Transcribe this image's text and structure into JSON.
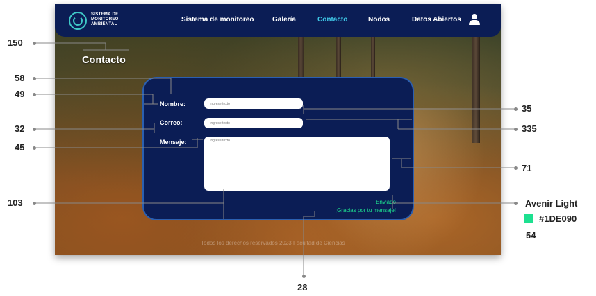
{
  "logo": {
    "line1": "SISTEMA DE",
    "line2": "MONITOREO",
    "line3": "AMBIENTAL"
  },
  "nav": {
    "items": [
      {
        "label": "Sistema de monitoreo"
      },
      {
        "label": "Galería"
      },
      {
        "label": "Contacto",
        "active": true
      },
      {
        "label": "Nodos"
      },
      {
        "label": "Datos Abiertos"
      }
    ],
    "user_icon": "user-icon"
  },
  "page": {
    "title": "Contacto"
  },
  "form": {
    "name_label": "Nombre:",
    "name_placeholder": "Ingrese texto",
    "email_label": "Correo:",
    "email_placeholder": "Ingrese texto",
    "message_label": "Mensaje:",
    "message_placeholder": "Ingrese texto",
    "status_sent": "Enviado",
    "status_thanks": "¡Gracias por tu mensaje!"
  },
  "footer_text": "Todos los derechos reservados 2023 Facultad de Ciencias",
  "annotations": {
    "a150": "150",
    "a58": "58",
    "a49": "49",
    "a32": "32",
    "a45": "45",
    "a103": "103",
    "a35": "35",
    "a335": "335",
    "a71": "71",
    "a28": "28",
    "a54": "54",
    "font": "Avenir Light",
    "color_hex": "#1DE090"
  },
  "colors": {
    "accent": "#1DE090",
    "navy": "#0b1d55",
    "nav_active": "#3fc7e6",
    "annotation_line": "#888888"
  }
}
